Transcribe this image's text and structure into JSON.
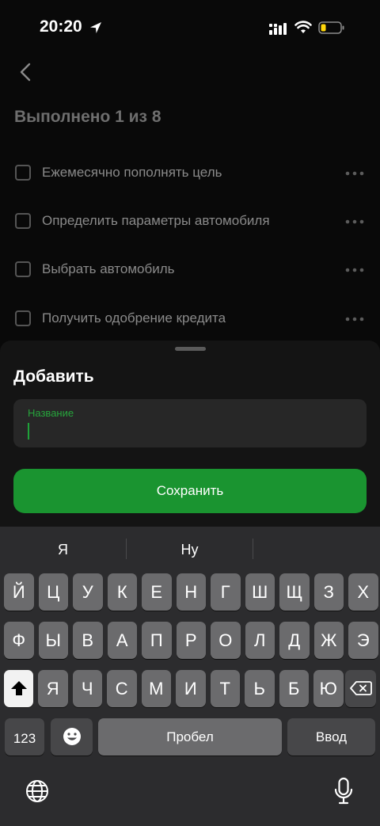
{
  "status_bar": {
    "time": "20:20",
    "icons": [
      "location-arrow-icon",
      "cellular-signal-icon",
      "wifi-icon",
      "battery-low-icon"
    ]
  },
  "header": {
    "back_icon": "chevron-left-icon"
  },
  "progress_title": "Выполнено 1 из 8",
  "tasks": [
    {
      "label": "Ежемесячно пополнять цель",
      "checked": false
    },
    {
      "label": "Определить параметры автомобиля",
      "checked": false
    },
    {
      "label": "Выбрать автомобиль",
      "checked": false
    },
    {
      "label": "Получить одобрение кредита",
      "checked": false
    }
  ],
  "sheet": {
    "title": "Добавить",
    "field_label": "Название",
    "field_value": "",
    "save_label": "Сохранить"
  },
  "keyboard": {
    "suggestions": [
      "Я",
      "Ну",
      ""
    ],
    "row1": [
      "Й",
      "Ц",
      "У",
      "К",
      "Е",
      "Н",
      "Г",
      "Ш",
      "Щ",
      "З",
      "Х"
    ],
    "row2": [
      "Ф",
      "Ы",
      "В",
      "А",
      "П",
      "Р",
      "О",
      "Л",
      "Д",
      "Ж",
      "Э"
    ],
    "row3": [
      "Я",
      "Ч",
      "С",
      "М",
      "И",
      "Т",
      "Ь",
      "Б",
      "Ю"
    ],
    "numbers_label": "123",
    "space_label": "Пробел",
    "return_label": "Ввод"
  },
  "colors": {
    "accent": "#1a9430",
    "background": "#090909",
    "sheet": "#141414"
  }
}
